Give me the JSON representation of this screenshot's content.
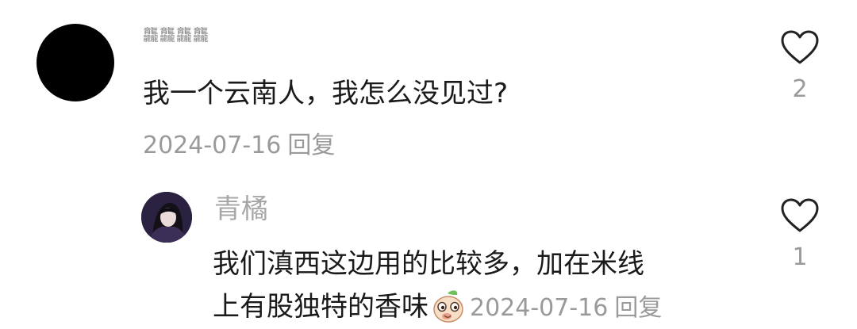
{
  "comments": [
    {
      "username": "龘龘龘龘",
      "text": "我一个云南人，我怎么没见过?",
      "date": "2024-07-16",
      "reply_label": "回复",
      "like_count": "2"
    },
    {
      "username": "青橘",
      "text_line1": "我们滇西这边用的比较多，加在米线",
      "text_line2": "上有股独特的香味",
      "emoji": "peach-smirk-emoji",
      "date": "2024-07-16",
      "reply_label": "回复",
      "like_count": "1"
    }
  ],
  "colors": {
    "text_primary": "#1a1a1a",
    "text_secondary": "#9a9a9a",
    "heart_outline": "#222222"
  }
}
